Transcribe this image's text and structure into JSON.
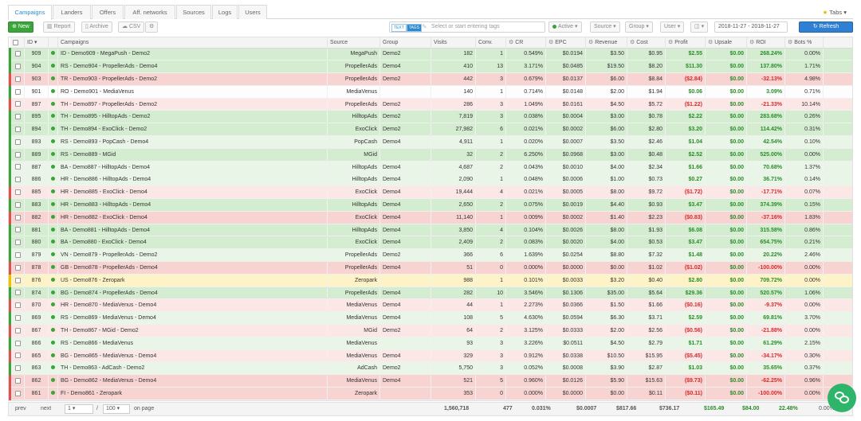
{
  "tabs": [
    "Campaigns",
    "Landers",
    "Offers",
    "Aff. networks",
    "Sources",
    "Logs",
    "Users"
  ],
  "tabs_right": "Tabs",
  "toolbar": {
    "new": "New",
    "report": "Report",
    "archive": "Archive",
    "csv": "CSV",
    "tag_text": "TEXT",
    "tag_tags": "TAGS",
    "tag_placeholder": "Select or start entering tags",
    "filter_active": "Active",
    "filter_source": "Source",
    "filter_group": "Group",
    "filter_user": "User",
    "date_range": "2018-11-27 - 2018-11-27",
    "refresh": "Refresh"
  },
  "columns": [
    "ID",
    "Campaigns",
    "Source",
    "Group",
    "Visits",
    "Conv.",
    "CR",
    "EPC",
    "Revenue",
    "Cost",
    "Profit",
    "Upsale",
    "ROI",
    "Bots %"
  ],
  "rows": [
    {
      "s": "green",
      "id": "909",
      "name": "ID - Demo909 - MegaPush - Demo2",
      "source": "MegaPush",
      "group": "Demo2",
      "visits": "182",
      "conv": "1",
      "cr": "0.549%",
      "epc": "$0.0194",
      "rev": "$3.50",
      "cost": "$0.95",
      "profit": "$2.55",
      "up": "$0.00",
      "roi": "268.24%",
      "bots": "0.00%"
    },
    {
      "s": "green",
      "id": "904",
      "name": "RS - Demo904 - PropellerAds - Demo4",
      "source": "PropellerAds",
      "group": "Demo4",
      "visits": "410",
      "conv": "13",
      "cr": "3.171%",
      "epc": "$0.0485",
      "rev": "$19.50",
      "cost": "$8.20",
      "profit": "$11.30",
      "up": "$0.00",
      "roi": "137.80%",
      "bots": "1.71%"
    },
    {
      "s": "red",
      "id": "903",
      "name": "TR - Demo903 - PropellerAds - Demo2",
      "source": "PropellerAds",
      "group": "Demo2",
      "visits": "442",
      "conv": "3",
      "cr": "0.679%",
      "epc": "$0.0137",
      "rev": "$6.00",
      "cost": "$8.84",
      "profit": "($2.84)",
      "up": "$0.00",
      "roi": "-32.13%",
      "bots": "4.98%"
    },
    {
      "s": "white",
      "id": "901",
      "name": "RO - Demo901 - MediaVenus",
      "source": "MediaVenus",
      "group": "",
      "visits": "140",
      "conv": "1",
      "cr": "0.714%",
      "epc": "$0.0148",
      "rev": "$2.00",
      "cost": "$1.94",
      "profit": "$0.06",
      "up": "$0.00",
      "roi": "3.09%",
      "bots": "0.71%"
    },
    {
      "s": "lred",
      "id": "897",
      "name": "TH - Demo897 - PropellerAds - Demo2",
      "source": "PropellerAds",
      "group": "Demo2",
      "visits": "286",
      "conv": "3",
      "cr": "1.049%",
      "epc": "$0.0161",
      "rev": "$4.50",
      "cost": "$5.72",
      "profit": "($1.22)",
      "up": "$0.00",
      "roi": "-21.33%",
      "bots": "10.14%"
    },
    {
      "s": "green",
      "id": "895",
      "name": "TH - Demo895 - HilltopAds - Demo2",
      "source": "HilltopAds",
      "group": "Demo2",
      "visits": "7,819",
      "conv": "3",
      "cr": "0.038%",
      "epc": "$0.0004",
      "rev": "$3.00",
      "cost": "$0.78",
      "profit": "$2.22",
      "up": "$0.00",
      "roi": "283.68%",
      "bots": "0.26%"
    },
    {
      "s": "green",
      "id": "894",
      "name": "TH - Demo894 - ExoClick - Demo2",
      "source": "ExoClick",
      "group": "Demo2",
      "visits": "27,982",
      "conv": "6",
      "cr": "0.021%",
      "epc": "$0.0002",
      "rev": "$6.00",
      "cost": "$2.80",
      "profit": "$3.20",
      "up": "$0.00",
      "roi": "114.42%",
      "bots": "0.31%"
    },
    {
      "s": "lgreen",
      "id": "893",
      "name": "RS - Demo893 - PopCash - Demo4",
      "source": "PopCash",
      "group": "Demo4",
      "visits": "4,911",
      "conv": "1",
      "cr": "0.020%",
      "epc": "$0.0007",
      "rev": "$3.50",
      "cost": "$2.46",
      "profit": "$1.04",
      "up": "$0.00",
      "roi": "42.54%",
      "bots": "0.10%"
    },
    {
      "s": "green",
      "id": "889",
      "name": "RS - Demo889 - MGid",
      "source": "MGid",
      "group": "",
      "visits": "32",
      "conv": "2",
      "cr": "6.250%",
      "epc": "$0.0968",
      "rev": "$3.00",
      "cost": "$0.48",
      "profit": "$2.52",
      "up": "$0.00",
      "roi": "525.00%",
      "bots": "0.00%"
    },
    {
      "s": "lgreen",
      "id": "887",
      "name": "BA - Demo887 - HilltopAds - Demo4",
      "source": "HilltopAds",
      "group": "Demo4",
      "visits": "4,687",
      "conv": "2",
      "cr": "0.043%",
      "epc": "$0.0010",
      "rev": "$4.00",
      "cost": "$2.34",
      "profit": "$1.66",
      "up": "$0.00",
      "roi": "70.68%",
      "bots": "1.37%"
    },
    {
      "s": "lgreen",
      "id": "886",
      "name": "HR - Demo886 - HilltopAds - Demo4",
      "source": "HilltopAds",
      "group": "Demo4",
      "visits": "2,090",
      "conv": "1",
      "cr": "0.048%",
      "epc": "$0.0006",
      "rev": "$1.00",
      "cost": "$0.73",
      "profit": "$0.27",
      "up": "$0.00",
      "roi": "36.71%",
      "bots": "0.14%"
    },
    {
      "s": "lred",
      "id": "885",
      "name": "HR - Demo885 - ExoClick - Demo4",
      "source": "ExoClick",
      "group": "Demo4",
      "visits": "19,444",
      "conv": "4",
      "cr": "0.021%",
      "epc": "$0.0005",
      "rev": "$8.00",
      "cost": "$9.72",
      "profit": "($1.72)",
      "up": "$0.00",
      "roi": "-17.71%",
      "bots": "0.07%"
    },
    {
      "s": "green",
      "id": "883",
      "name": "HR - Demo883 - HilltopAds - Demo4",
      "source": "HilltopAds",
      "group": "Demo4",
      "visits": "2,650",
      "conv": "2",
      "cr": "0.075%",
      "epc": "$0.0019",
      "rev": "$4.40",
      "cost": "$0.93",
      "profit": "$3.47",
      "up": "$0.00",
      "roi": "374.39%",
      "bots": "0.15%"
    },
    {
      "s": "red",
      "id": "882",
      "name": "HR - Demo882 - ExoClick - Demo4",
      "source": "ExoClick",
      "group": "Demo4",
      "visits": "11,140",
      "conv": "1",
      "cr": "0.009%",
      "epc": "$0.0002",
      "rev": "$1.40",
      "cost": "$2.23",
      "profit": "($0.83)",
      "up": "$0.00",
      "roi": "-37.16%",
      "bots": "1.83%"
    },
    {
      "s": "green",
      "id": "881",
      "name": "BA - Demo881 - HilltopAds - Demo4",
      "source": "HilltopAds",
      "group": "Demo4",
      "visits": "3,850",
      "conv": "4",
      "cr": "0.104%",
      "epc": "$0.0026",
      "rev": "$8.00",
      "cost": "$1.93",
      "profit": "$6.08",
      "up": "$0.00",
      "roi": "315.58%",
      "bots": "0.86%"
    },
    {
      "s": "green",
      "id": "880",
      "name": "BA - Demo880 - ExoClick - Demo4",
      "source": "ExoClick",
      "group": "Demo4",
      "visits": "2,409",
      "conv": "2",
      "cr": "0.083%",
      "epc": "$0.0020",
      "rev": "$4.00",
      "cost": "$0.53",
      "profit": "$3.47",
      "up": "$0.00",
      "roi": "654.75%",
      "bots": "0.21%"
    },
    {
      "s": "lgreen",
      "id": "879",
      "name": "VN - Demo879 - PropellerAds - Demo2",
      "source": "PropellerAds",
      "group": "Demo2",
      "visits": "366",
      "conv": "6",
      "cr": "1.639%",
      "epc": "$0.0254",
      "rev": "$8.80",
      "cost": "$7.32",
      "profit": "$1.48",
      "up": "$0.00",
      "roi": "20.22%",
      "bots": "2.46%"
    },
    {
      "s": "red",
      "id": "878",
      "name": "GB - Demo878 - PropellerAds - Demo4",
      "source": "PropellerAds",
      "group": "Demo4",
      "visits": "51",
      "conv": "0",
      "cr": "0.000%",
      "epc": "$0.0000",
      "rev": "$0.00",
      "cost": "$1.02",
      "profit": "($1.02)",
      "up": "$0.00",
      "roi": "-100.00%",
      "bots": "0.00%"
    },
    {
      "s": "yellow",
      "id": "876",
      "name": "US - Demo876 - Zeropark",
      "source": "Zeropark",
      "group": "",
      "visits": "988",
      "conv": "1",
      "cr": "0.101%",
      "epc": "$0.0033",
      "rev": "$3.20",
      "cost": "$0.40",
      "profit": "$2.80",
      "up": "$0.00",
      "roi": "709.72%",
      "bots": "0.00%"
    },
    {
      "s": "green",
      "id": "874",
      "name": "BG - Demo874 - PropellerAds - Demo4",
      "source": "PropellerAds",
      "group": "Demo4",
      "visits": "282",
      "conv": "10",
      "cr": "3.546%",
      "epc": "$0.1306",
      "rev": "$35.00",
      "cost": "$5.64",
      "profit": "$29.36",
      "up": "$0.00",
      "roi": "520.57%",
      "bots": "1.06%"
    },
    {
      "s": "lred",
      "id": "870",
      "name": "HR - Demo870 - MediaVenus - Demo4",
      "source": "MediaVenus",
      "group": "Demo4",
      "visits": "44",
      "conv": "1",
      "cr": "2.273%",
      "epc": "$0.0366",
      "rev": "$1.50",
      "cost": "$1.66",
      "profit": "($0.16)",
      "up": "$0.00",
      "roi": "-9.37%",
      "bots": "0.00%"
    },
    {
      "s": "lgreen",
      "id": "869",
      "name": "RS - Demo869 - MediaVenus - Demo4",
      "source": "MediaVenus",
      "group": "Demo4",
      "visits": "108",
      "conv": "5",
      "cr": "4.630%",
      "epc": "$0.0594",
      "rev": "$6.30",
      "cost": "$3.71",
      "profit": "$2.59",
      "up": "$0.00",
      "roi": "69.81%",
      "bots": "3.70%"
    },
    {
      "s": "lred",
      "id": "867",
      "name": "TH - Demo867 - MGid - Demo2",
      "source": "MGid",
      "group": "Demo2",
      "visits": "64",
      "conv": "2",
      "cr": "3.125%",
      "epc": "$0.0333",
      "rev": "$2.00",
      "cost": "$2.56",
      "profit": "($0.56)",
      "up": "$0.00",
      "roi": "-21.88%",
      "bots": "0.00%"
    },
    {
      "s": "lgreen",
      "id": "866",
      "name": "RS - Demo866 - MediaVenus",
      "source": "MediaVenus",
      "group": "",
      "visits": "93",
      "conv": "3",
      "cr": "3.226%",
      "epc": "$0.0511",
      "rev": "$4.50",
      "cost": "$2.79",
      "profit": "$1.71",
      "up": "$0.00",
      "roi": "61.29%",
      "bots": "2.15%"
    },
    {
      "s": "lred",
      "id": "865",
      "name": "BG - Demo865 - MediaVenus - Demo4",
      "source": "MediaVenus",
      "group": "Demo4",
      "visits": "329",
      "conv": "3",
      "cr": "0.912%",
      "epc": "$0.0338",
      "rev": "$10.50",
      "cost": "$15.95",
      "profit": "($5.45)",
      "up": "$0.00",
      "roi": "-34.17%",
      "bots": "0.30%"
    },
    {
      "s": "lgreen",
      "id": "863",
      "name": "TH - Demo863 - AdCash - Demo2",
      "source": "AdCash",
      "group": "Demo2",
      "visits": "5,750",
      "conv": "3",
      "cr": "0.052%",
      "epc": "$0.0008",
      "rev": "$3.90",
      "cost": "$2.87",
      "profit": "$1.03",
      "up": "$0.00",
      "roi": "35.65%",
      "bots": "0.37%"
    },
    {
      "s": "red",
      "id": "862",
      "name": "BG - Demo862 - MediaVenus - Demo4",
      "source": "MediaVenus",
      "group": "Demo4",
      "visits": "521",
      "conv": "5",
      "cr": "0.960%",
      "epc": "$0.0126",
      "rev": "$5.90",
      "cost": "$15.63",
      "profit": "($9.73)",
      "up": "$0.00",
      "roi": "-62.25%",
      "bots": "0.96%"
    },
    {
      "s": "red",
      "id": "861",
      "name": "FI - Demo861 - Zeropark",
      "source": "Zeropark",
      "group": "",
      "visits": "353",
      "conv": "0",
      "cr": "0.000%",
      "epc": "$0.0000",
      "rev": "$0.00",
      "cost": "$0.11",
      "profit": "($0.11)",
      "up": "$0.00",
      "roi": "-100.00%",
      "bots": "0.00%"
    }
  ],
  "footer": {
    "prev": "prev",
    "next": "next",
    "page": "1",
    "sep": "/",
    "per_page": "100",
    "on_page": "on page",
    "visits": "1,560,718",
    "conv": "477",
    "cr": "0.031%",
    "epc": "$0.0007",
    "rev": "$817.66",
    "cost": "$736.17",
    "profit": "$165.49",
    "up": "$84.00",
    "roi": "22.48%",
    "bots": "0.00%"
  }
}
